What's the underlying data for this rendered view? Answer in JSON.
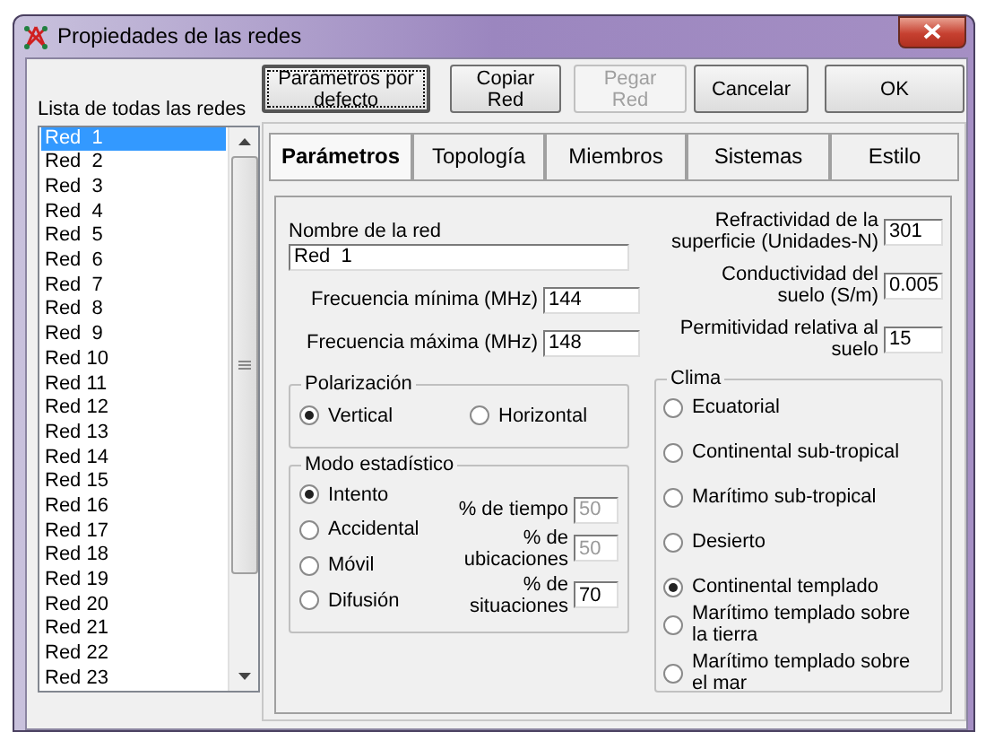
{
  "window": {
    "title": "Propiedades de las redes"
  },
  "network_list": {
    "label": "Lista de todas las redes",
    "items": [
      {
        "label": "Red  1",
        "selected": true
      },
      {
        "label": "Red  2",
        "selected": false
      },
      {
        "label": "Red  3",
        "selected": false
      },
      {
        "label": "Red  4",
        "selected": false
      },
      {
        "label": "Red  5",
        "selected": false
      },
      {
        "label": "Red  6",
        "selected": false
      },
      {
        "label": "Red  7",
        "selected": false
      },
      {
        "label": "Red  8",
        "selected": false
      },
      {
        "label": "Red  9",
        "selected": false
      },
      {
        "label": "Red 10",
        "selected": false
      },
      {
        "label": "Red 11",
        "selected": false
      },
      {
        "label": "Red 12",
        "selected": false
      },
      {
        "label": "Red 13",
        "selected": false
      },
      {
        "label": "Red 14",
        "selected": false
      },
      {
        "label": "Red 15",
        "selected": false
      },
      {
        "label": "Red 16",
        "selected": false
      },
      {
        "label": "Red 17",
        "selected": false
      },
      {
        "label": "Red 18",
        "selected": false
      },
      {
        "label": "Red 19",
        "selected": false
      },
      {
        "label": "Red 20",
        "selected": false
      },
      {
        "label": "Red 21",
        "selected": false
      },
      {
        "label": "Red 22",
        "selected": false
      },
      {
        "label": "Red 23",
        "selected": false
      }
    ]
  },
  "buttons": [
    {
      "label": "Parámetros por defecto",
      "disabled": false,
      "focused": true
    },
    {
      "label": "Copiar Red",
      "disabled": false,
      "focused": false
    },
    {
      "label": "Pegar Red",
      "disabled": true,
      "focused": false
    },
    {
      "label": "Cancelar",
      "disabled": false,
      "focused": false
    },
    {
      "label": "OK",
      "disabled": false,
      "focused": false
    }
  ],
  "tabs": [
    {
      "label": "Parámetros",
      "selected": true
    },
    {
      "label": "Topología",
      "selected": false
    },
    {
      "label": "Miembros",
      "selected": false
    },
    {
      "label": "Sistemas",
      "selected": false
    },
    {
      "label": "Estilo",
      "selected": false
    }
  ],
  "network_name": {
    "label": "Nombre de la red",
    "value": "Red  1"
  },
  "left_fields": [
    {
      "label": "Frecuencia mínima (MHz)",
      "value": "144"
    },
    {
      "label": "Frecuencia máxima (MHz)",
      "value": "148"
    }
  ],
  "right_fields": [
    {
      "label": "Refractividad de la superficie (Unidades-N)",
      "value": "301"
    },
    {
      "label": "Conductividad del suelo (S/m)",
      "value": "0.005"
    },
    {
      "label": "Permitividad relativa al suelo",
      "value": "15"
    }
  ],
  "polarization": {
    "title": "Polarización",
    "options": [
      {
        "label": "Vertical",
        "selected": true
      },
      {
        "label": "Horizontal",
        "selected": false
      }
    ]
  },
  "statistical_mode": {
    "title": "Modo estadístico",
    "options": [
      {
        "label": "Intento",
        "selected": true
      },
      {
        "label": "Accidental",
        "selected": false
      },
      {
        "label": "Móvil",
        "selected": false
      },
      {
        "label": "Difusión",
        "selected": false
      }
    ],
    "fields": [
      {
        "label": "% de tiempo",
        "value": "50",
        "disabled": true
      },
      {
        "label": "% de ubicaciones",
        "value": "50",
        "disabled": true
      },
      {
        "label": "% de situaciones",
        "value": "70",
        "disabled": false
      }
    ]
  },
  "climate": {
    "title": "Clima",
    "options": [
      {
        "label": "Ecuatorial",
        "selected": false
      },
      {
        "label": "Continental sub-tropical",
        "selected": false
      },
      {
        "label": "Marítimo sub-tropical",
        "selected": false
      },
      {
        "label": "Desierto",
        "selected": false
      },
      {
        "label": "Continental templado",
        "selected": true
      },
      {
        "label": "Marítimo templado sobre la tierra",
        "selected": false
      },
      {
        "label": "Marítimo templado sobre el mar",
        "selected": false
      }
    ]
  }
}
